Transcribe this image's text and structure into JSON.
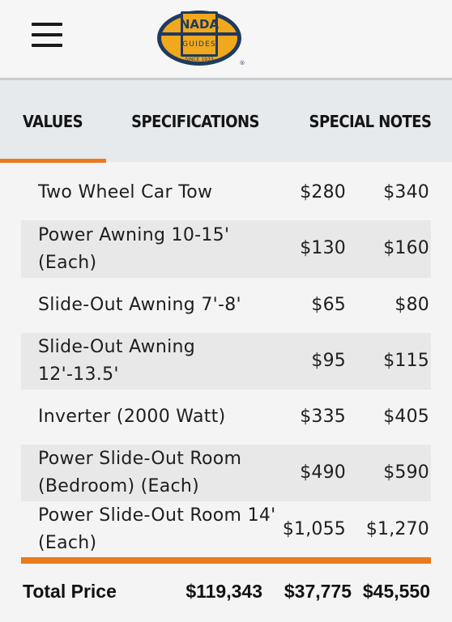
{
  "header": {
    "logo": {
      "top_text": "NADA",
      "sub_text": "GUIDES",
      "since_text": "SINCE 1933",
      "registered_mark": "®"
    },
    "menu_icon": "hamburger-menu-icon"
  },
  "tabs": [
    {
      "label": "VALUES",
      "active": true
    },
    {
      "label": "SPECIFICATIONS",
      "active": false
    },
    {
      "label": "SPECIAL NOTES",
      "active": false
    }
  ],
  "rows": [
    {
      "name": "Two Wheel Car Tow",
      "v1": "$280",
      "v2": "$340"
    },
    {
      "name": "Power Awning 10-15' (Each)",
      "v1": "$130",
      "v2": "$160"
    },
    {
      "name": "Slide-Out Awning 7'-8'",
      "v1": "$65",
      "v2": "$80"
    },
    {
      "name": "Slide-Out Awning 12'-13.5'",
      "v1": "$95",
      "v2": "$115"
    },
    {
      "name": "Inverter (2000 Watt)",
      "v1": "$335",
      "v2": "$405"
    },
    {
      "name": "Power Slide-Out Room (Bedroom) (Each)",
      "v1": "$490",
      "v2": "$590"
    },
    {
      "name": "Power Slide-Out Room 14' (Each)",
      "v1": "$1,055",
      "v2": "$1,270"
    }
  ],
  "total": {
    "label": "Total Price",
    "v0": "$119,343",
    "v1": "$37,775",
    "v2": "$45,550"
  },
  "colors": {
    "accent": "#ea7a1b",
    "logo_navy": "#1f3a5f",
    "logo_orange": "#f0a81c"
  }
}
